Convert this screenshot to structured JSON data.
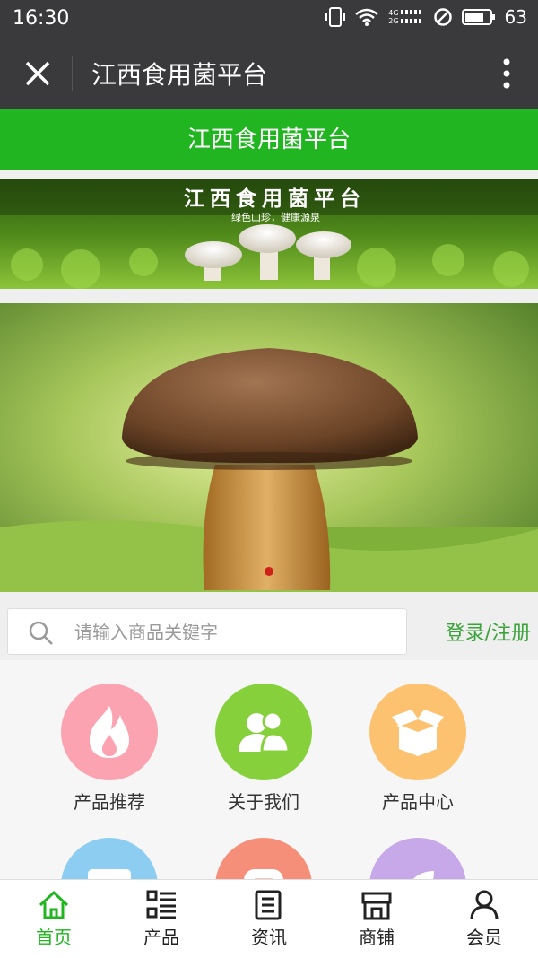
{
  "status": {
    "time": "16:30",
    "battery": "63",
    "network_top": "4G",
    "network_bottom": "2G"
  },
  "header": {
    "title": "江西食用菌平台"
  },
  "greenbar": {
    "title": "江西食用菌平台"
  },
  "banner": {
    "headline": "江西食用菌平台",
    "slogan": "绿色山珍，健康源泉"
  },
  "search": {
    "placeholder": "请输入商品关键字",
    "value": "",
    "login_label": "登录/注册"
  },
  "menu": {
    "items": [
      {
        "label": "产品推荐",
        "color": "#fba3b1",
        "icon": "fire-icon"
      },
      {
        "label": "关于我们",
        "color": "#86d13b",
        "icon": "users-icon"
      },
      {
        "label": "产品中心",
        "color": "#fcc270",
        "icon": "box-icon"
      },
      {
        "label": "",
        "color": "#8dcdf2",
        "icon": "message-icon"
      },
      {
        "label": "",
        "color": "#f68f7a",
        "icon": "chat-icon"
      },
      {
        "label": "",
        "color": "#c7a8e8",
        "icon": "leaf-icon"
      }
    ]
  },
  "tabs": [
    {
      "label": "首页",
      "icon": "home-icon",
      "active": true
    },
    {
      "label": "产品",
      "icon": "list-icon"
    },
    {
      "label": "资讯",
      "icon": "news-icon"
    },
    {
      "label": "商铺",
      "icon": "shop-icon"
    },
    {
      "label": "会员",
      "icon": "user-icon"
    }
  ],
  "colors": {
    "accent": "#22b522",
    "titlebar": "#3a3a3c"
  }
}
